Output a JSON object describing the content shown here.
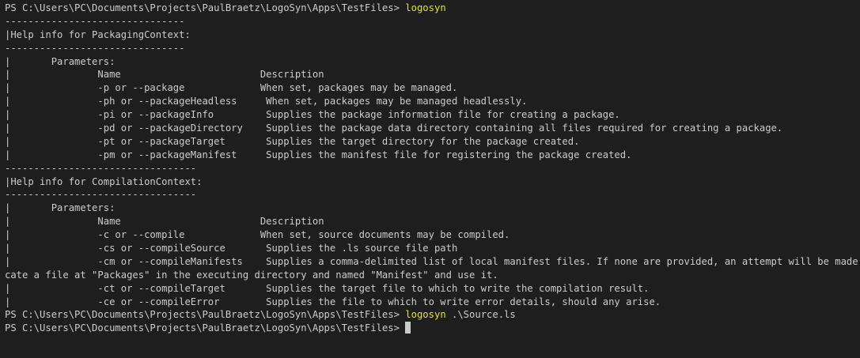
{
  "terminal": {
    "prompt": "PS C:\\Users\\PC\\Documents\\Projects\\PaulBraetz\\LogoSyn\\Apps\\TestFiles> ",
    "first_command": "logosyn",
    "second_command": "logosyn",
    "second_command_args": " .\\Source.ls",
    "lines": [
      "-------------------------------",
      "|Help info for PackagingContext:",
      "-------------------------------",
      "|       Parameters:",
      "|               Name                        Description",
      "|               -p or --package             When set, packages may be managed.",
      "|               -ph or --packageHeadless     When set, packages may be managed headlessly.",
      "|               -pi or --packageInfo         Supplies the package information file for creating a package.",
      "|               -pd or --packageDirectory    Supplies the package data directory containing all files required for creating a package.",
      "|               -pt or --packageTarget       Supplies the target directory for the package created.",
      "|               -pm or --packageManifest     Supplies the manifest file for registering the package created.",
      "---------------------------------",
      "|Help info for CompilationContext:",
      "---------------------------------",
      "|       Parameters:",
      "|               Name                        Description",
      "|               -c or --compile             When set, source documents may be compiled.",
      "|               -cs or --compileSource       Supplies the .ls source file path",
      "|               -cm or --compileManifests    Supplies a comma-delimited list of local manifest files. If none are provided, an attempt will be made to lo",
      "cate a file at \"Packages\" in the executing directory and named \"Manifest\" and use it.",
      "|               -ct or --compileTarget       Supplies the target file to which to write the compilation result.",
      "|               -ce or --compileError        Supplies the file to which to write error details, should any arise."
    ]
  }
}
